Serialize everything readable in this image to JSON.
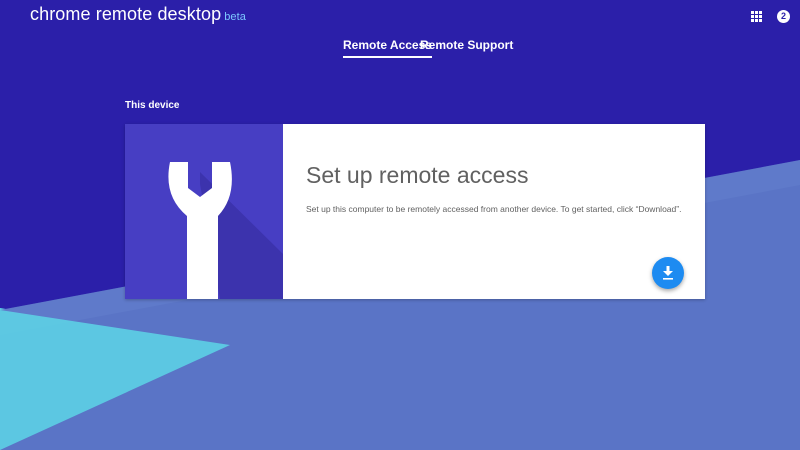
{
  "header": {
    "app_title": "chrome remote desktop",
    "beta_label": "beta",
    "apps_icon": "apps-grid-icon",
    "account_badge": "2"
  },
  "tabs": [
    {
      "label": "Remote Access",
      "active": true
    },
    {
      "label": "Remote Support",
      "active": false
    }
  ],
  "section": {
    "label": "This device"
  },
  "card": {
    "icon": "wrench-icon",
    "title": "Set up remote access",
    "description": "Set up this computer to be remotely accessed from another device. To get started, click “Download”.",
    "action_icon": "download-icon"
  },
  "colors": {
    "background": "#2b1fa9",
    "hero": "#473ec3",
    "accent": "#1d8bf1",
    "beta": "#7cc7ff",
    "teal": "#5dd6e6",
    "slate_blue": "#5a74c6"
  }
}
